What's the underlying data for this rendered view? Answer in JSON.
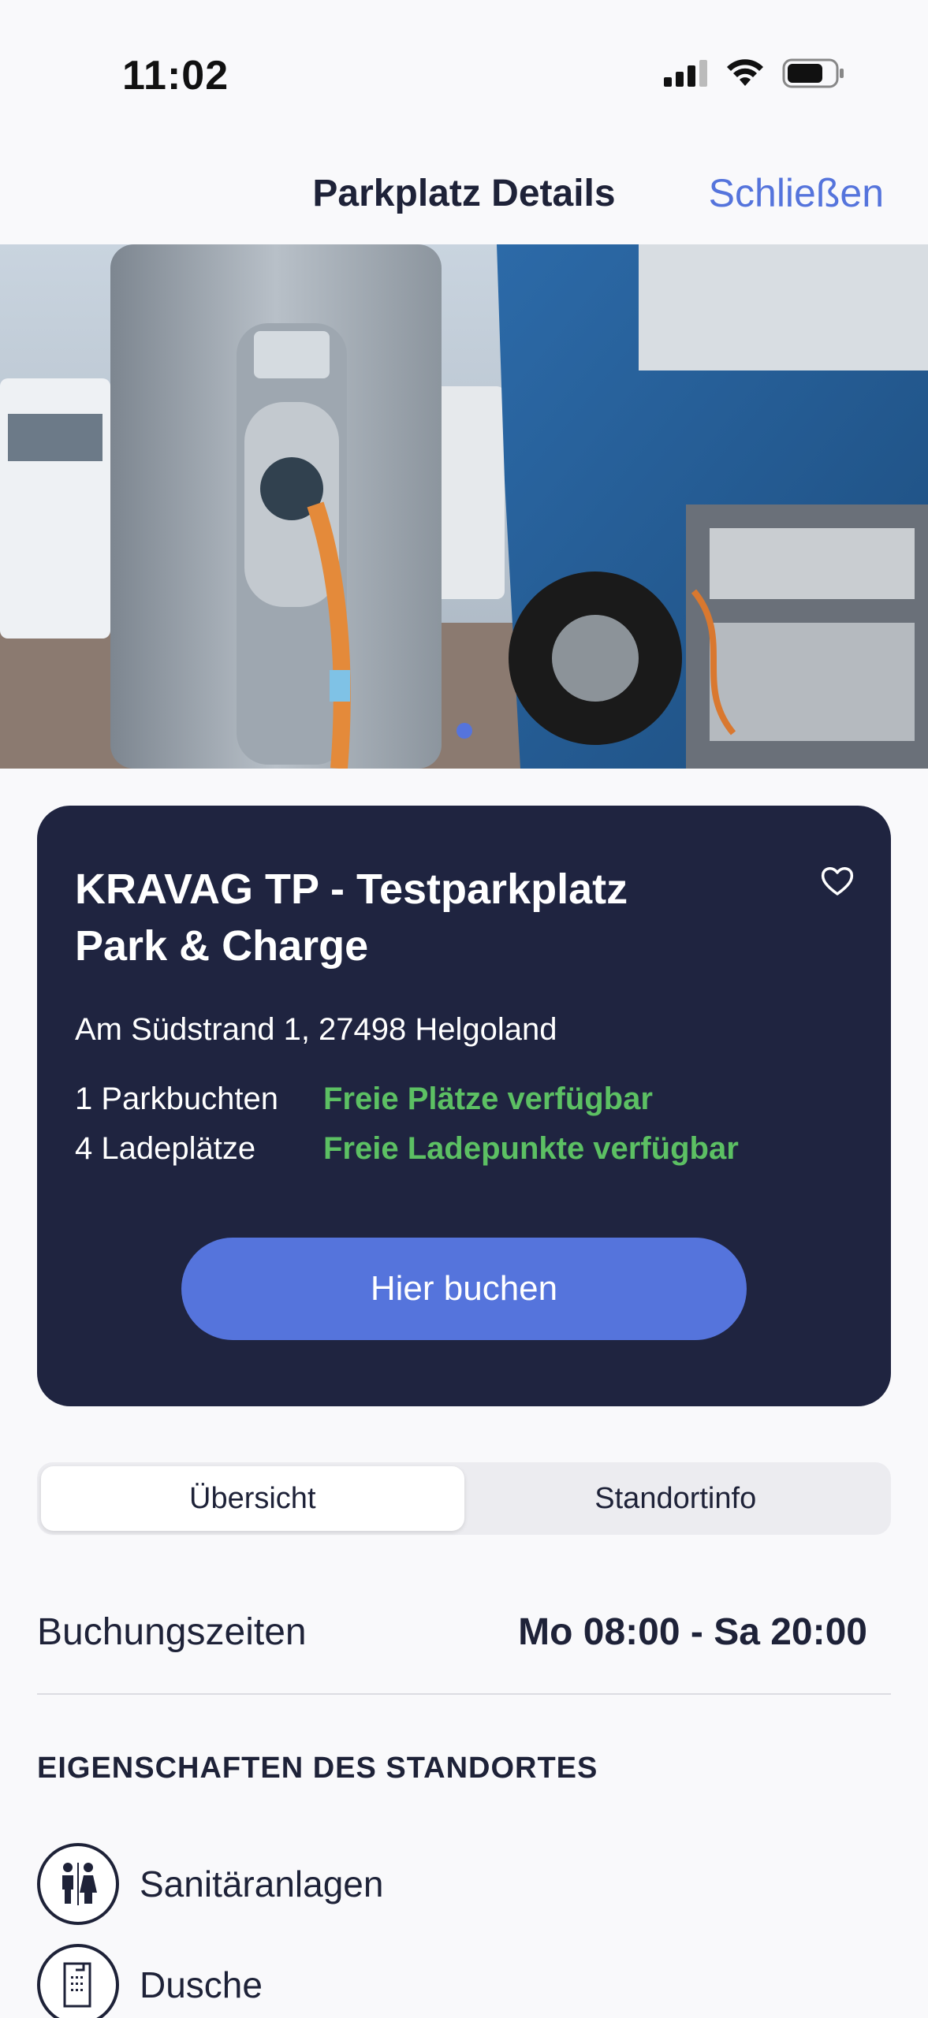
{
  "status_bar": {
    "time": "11:02"
  },
  "nav": {
    "title": "Parkplatz Details",
    "close_label": "Schließen"
  },
  "carousel": {
    "page_count": 1,
    "active_index": 0
  },
  "card": {
    "title_line1": "KRAVAG TP - Testparkplatz",
    "title_line2": "Park & Charge",
    "address": "Am Südstrand 1, 27498 Helgoland",
    "parking": {
      "label": "1 Parkbuchten",
      "status": "Freie Plätze verfügbar"
    },
    "charging": {
      "label": "4 Ladeplätze",
      "status": "Freie Ladepunkte verfügbar"
    },
    "book_label": "Hier buchen",
    "favorite_icon": "heart-outline-icon",
    "status_color": "#5cc063"
  },
  "tabs": [
    {
      "label": "Übersicht",
      "active": true
    },
    {
      "label": "Standortinfo",
      "active": false
    }
  ],
  "booking_times": {
    "label": "Buchungszeiten",
    "value": "Mo 08:00 - Sa 20:00"
  },
  "features_section": {
    "title": "EIGENSCHAFTEN DES STANDORTES",
    "items": [
      {
        "icon": "restroom-icon",
        "label": "Sanitäranlagen"
      },
      {
        "icon": "shower-icon",
        "label": "Dusche"
      }
    ]
  },
  "colors": {
    "accent": "#5574dc",
    "card_bg": "#1f2440",
    "text": "#1e2238"
  }
}
